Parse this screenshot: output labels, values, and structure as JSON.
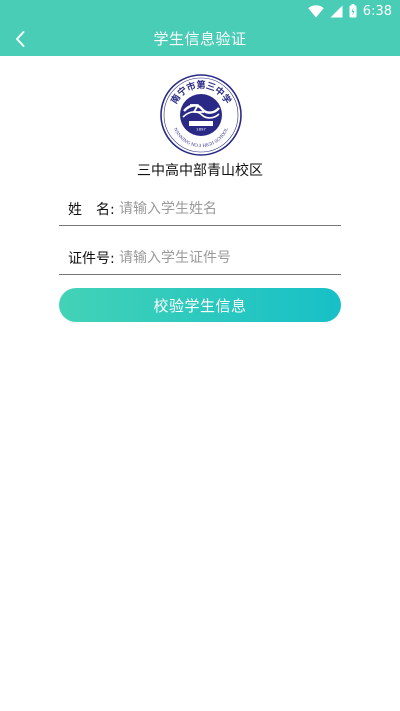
{
  "status_bar": {
    "time": "6:38",
    "icons": [
      "wifi-icon",
      "cellular-signal-icon",
      "battery-icon"
    ]
  },
  "header": {
    "title": "学生信息验证",
    "back_icon": "back-arrow-icon"
  },
  "school": {
    "logo_text_top": "南宁市第三中学",
    "logo_text_bottom": "NANNING NO.3 HIGH SCHOOL",
    "logo_year": "1897",
    "campus_name": "三中高中部青山校区"
  },
  "form": {
    "name_label": "姓　名:",
    "name_placeholder": "请输入学生姓名",
    "id_label": "证件号:",
    "id_placeholder": "请输入学生证件号",
    "submit_label": "校验学生信息"
  },
  "colors": {
    "primary": "#49cdb6",
    "button_start": "#43d2b6",
    "button_end": "#17c0c7",
    "logo": "#2a2a86"
  }
}
